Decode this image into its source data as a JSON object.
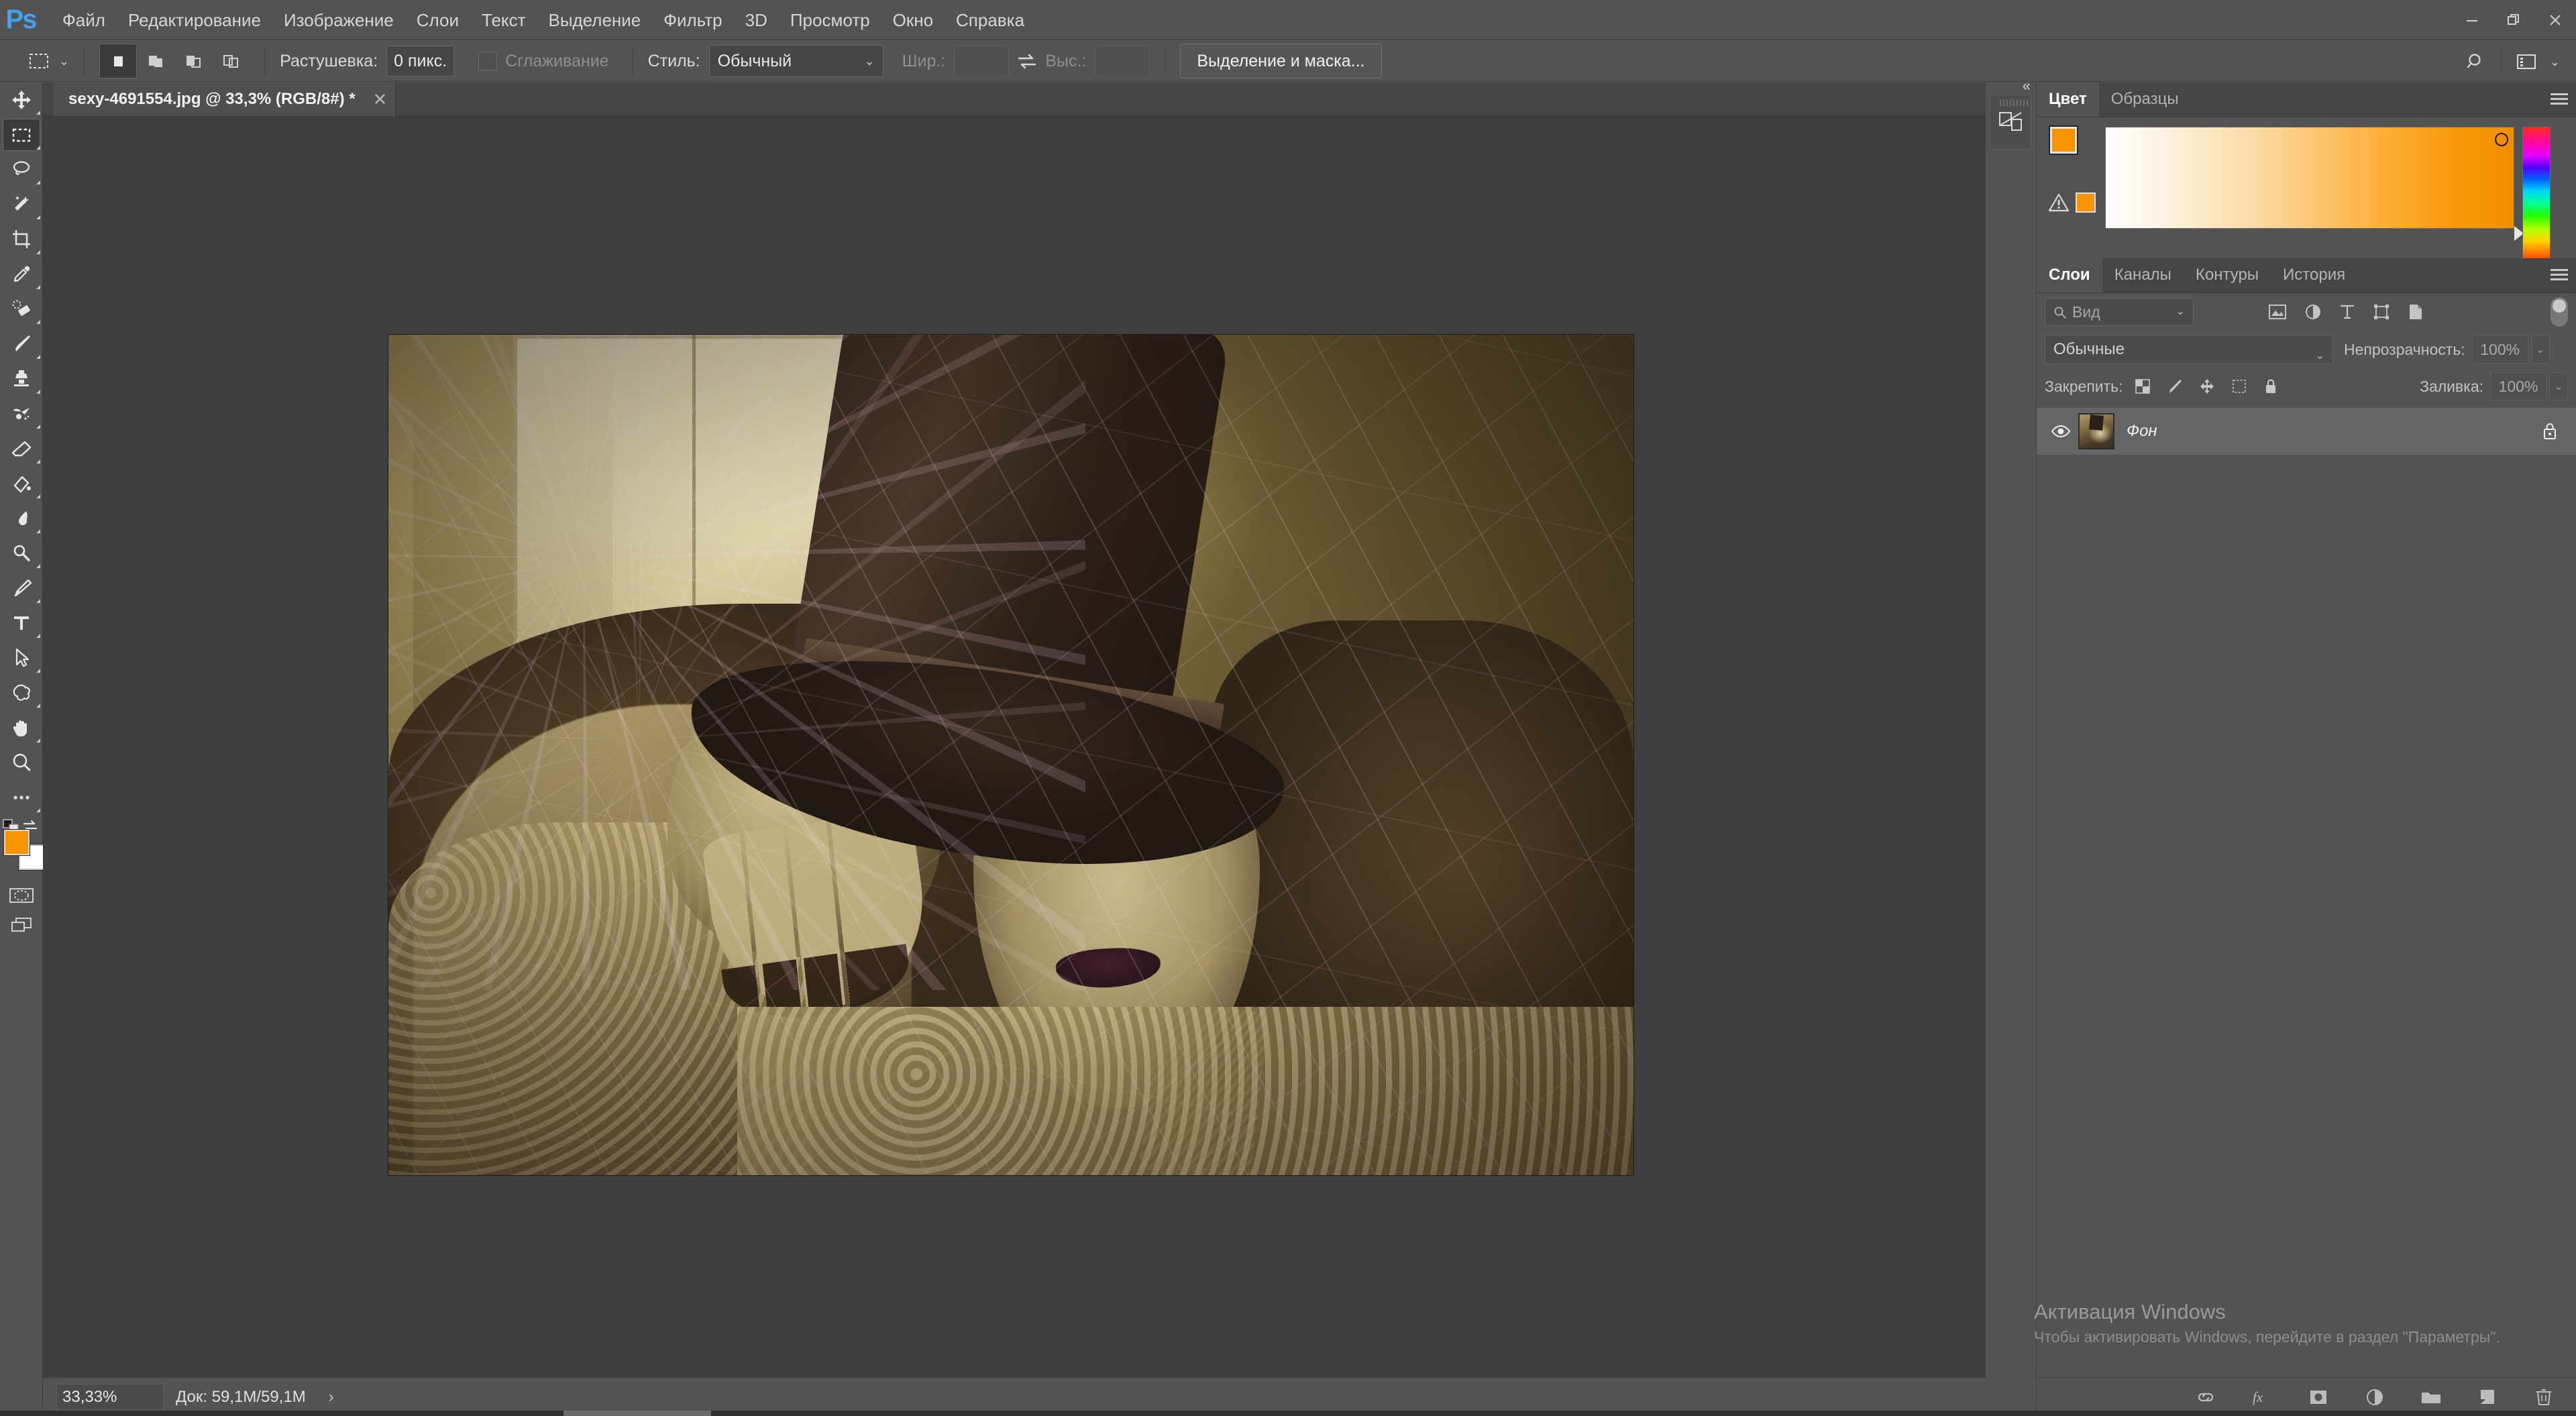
{
  "app": {
    "name": "Adobe Photoshop",
    "logo_text": "Ps",
    "logo_color": "#46a0f0"
  },
  "menubar": {
    "items": [
      {
        "label": "Файл"
      },
      {
        "label": "Редактирование"
      },
      {
        "label": "Изображение"
      },
      {
        "label": "Слои"
      },
      {
        "label": "Текст"
      },
      {
        "label": "Выделение"
      },
      {
        "label": "Фильтр"
      },
      {
        "label": "3D"
      },
      {
        "label": "Просмотр"
      },
      {
        "label": "Окно"
      },
      {
        "label": "Справка"
      }
    ],
    "window_controls": {
      "minimize": "minimize-icon",
      "restore": "restore-icon",
      "close": "close-icon"
    }
  },
  "options_bar": {
    "active_tool": "rectangular-marquee",
    "selection_modes": [
      "new-selection",
      "add-to-selection",
      "subtract-from-selection",
      "intersect-with-selection"
    ],
    "active_selection_mode": 0,
    "feather_label": "Растушевка:",
    "feather_value": "0 пикс.",
    "antialias_label": "Сглаживание",
    "antialias_checked": false,
    "style_label": "Стиль:",
    "style_value": "Обычный",
    "width_label": "Шир.:",
    "width_value": "",
    "height_label": "Выс.:",
    "height_value": "",
    "swap_icon": "swap-width-height-icon",
    "select_and_mask_button": "Выделение и маска...",
    "search_icon": "search-icon",
    "workspace_icon": "workspace-switcher-icon"
  },
  "toolbar": {
    "tools": [
      {
        "name": "move-tool",
        "selected": false
      },
      {
        "name": "rectangular-marquee-tool",
        "selected": true
      },
      {
        "name": "lasso-tool",
        "selected": false
      },
      {
        "name": "quick-selection-tool",
        "selected": false
      },
      {
        "name": "crop-tool",
        "selected": false
      },
      {
        "name": "eyedropper-tool",
        "selected": false
      },
      {
        "name": "spot-healing-brush-tool",
        "selected": false
      },
      {
        "name": "brush-tool",
        "selected": false
      },
      {
        "name": "clone-stamp-tool",
        "selected": false
      },
      {
        "name": "history-brush-tool",
        "selected": false
      },
      {
        "name": "eraser-tool",
        "selected": false
      },
      {
        "name": "gradient-tool",
        "selected": false
      },
      {
        "name": "blur-tool",
        "selected": false
      },
      {
        "name": "dodge-tool",
        "selected": false
      },
      {
        "name": "pen-tool",
        "selected": false
      },
      {
        "name": "horizontal-type-tool",
        "selected": false
      },
      {
        "name": "path-selection-tool",
        "selected": false
      },
      {
        "name": "custom-shape-tool",
        "selected": false
      },
      {
        "name": "hand-tool",
        "selected": false
      },
      {
        "name": "zoom-tool",
        "selected": false
      },
      {
        "name": "edit-toolbar-tool",
        "selected": false
      }
    ],
    "foreground_color": "#f79400",
    "background_color": "#ffffff",
    "quick_mask_icon": "quick-mask-mode-icon",
    "screen_mode_icon": "screen-mode-icon"
  },
  "document": {
    "tab_title": "sexy-4691554.jpg @ 33,3% (RGB/8#) *",
    "close_icon": "close-tab-icon"
  },
  "status_bar": {
    "zoom": "33,33%",
    "doc_info": "Док: 59,1M/59,1M",
    "expand_arrow": "›"
  },
  "collapsed_panel": {
    "collapse_icon": "collapse-panels-icon",
    "button_icon": "libraries-icon"
  },
  "color_panel": {
    "tabs": [
      {
        "label": "Цвет",
        "active": true
      },
      {
        "label": "Образцы",
        "active": false
      }
    ],
    "menu_icon": "panel-menu-icon",
    "foreground": "#f79400",
    "background": "#ffffff",
    "out_of_gamut_warning_icon": "gamut-warning-icon",
    "out_of_gamut_color": "#f79400"
  },
  "layers_panel": {
    "tabs": [
      {
        "label": "Слои",
        "active": true
      },
      {
        "label": "Каналы",
        "active": false
      },
      {
        "label": "Контуры",
        "active": false
      },
      {
        "label": "История",
        "active": false
      }
    ],
    "menu_icon": "panel-menu-icon",
    "filter": {
      "placeholder": "Вид",
      "search_icon": "search-icon",
      "chevron": "⌄",
      "type_icons": [
        "filter-pixel-icon",
        "filter-adjustment-icon",
        "filter-type-icon",
        "filter-shape-icon",
        "filter-smart-object-icon"
      ],
      "toggle_on": false
    },
    "blend_mode": "Обычные",
    "opacity_label": "Непрозрачность:",
    "opacity_value": "100%",
    "lock_label": "Закрепить:",
    "lock_icons": [
      "lock-transparent-pixels-icon",
      "lock-image-pixels-icon",
      "lock-position-icon",
      "lock-artboard-icon",
      "lock-all-icon"
    ],
    "fill_label": "Заливка:",
    "fill_value": "100%",
    "layers": [
      {
        "name": "Фон",
        "visible": true,
        "locked": true,
        "eye_icon": "eye-icon",
        "lock_icon": "lock-icon"
      }
    ],
    "bottom_icons": [
      {
        "name": "link-layers-icon"
      },
      {
        "name": "layer-style-fx-icon"
      },
      {
        "name": "add-layer-mask-icon"
      },
      {
        "name": "new-adjustment-layer-icon"
      },
      {
        "name": "new-group-icon"
      },
      {
        "name": "new-layer-icon"
      },
      {
        "name": "delete-layer-icon"
      }
    ]
  },
  "watermark": {
    "title": "Активация Windows",
    "subtitle": "Чтобы активировать Windows, перейдите в раздел \"Параметры\"."
  }
}
